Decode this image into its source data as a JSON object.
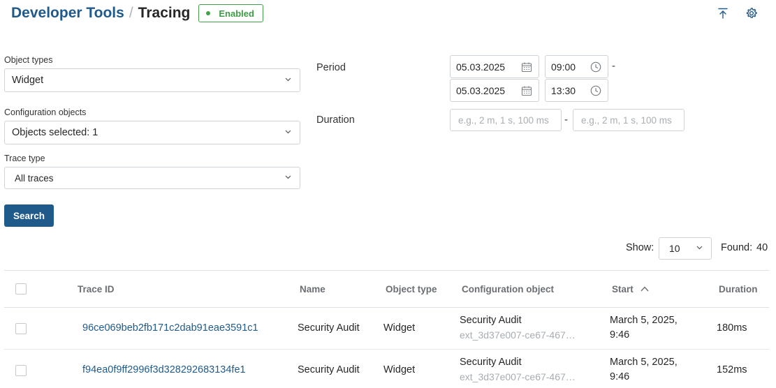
{
  "header": {
    "breadcrumb_root": "Developer Tools",
    "separator": "/",
    "title": "Tracing",
    "status_badge": "Enabled"
  },
  "toolbar_icons": [
    "export-icon",
    "gear-icon"
  ],
  "filters": {
    "object_types": {
      "label": "Object types",
      "value": "Widget"
    },
    "configuration_objects": {
      "label": "Configuration objects",
      "value": "Objects selected: 1"
    },
    "trace_type": {
      "label": "Trace type",
      "value": "All traces"
    },
    "period": {
      "label": "Period",
      "from_date": "05.03.2025",
      "from_time": "09:00",
      "to_date": "05.03.2025",
      "to_time": "13:30",
      "separator": "-"
    },
    "duration": {
      "label": "Duration",
      "from_placeholder": "e.g., 2 m, 1 s, 100 ms",
      "to_placeholder": "e.g., 2 m, 1 s, 100 ms",
      "separator": "-"
    }
  },
  "search_button": "Search",
  "results": {
    "show_label": "Show:",
    "page_size": "10",
    "found_label": "Found:",
    "found_count": "40"
  },
  "table": {
    "columns": {
      "trace_id": "Trace ID",
      "name": "Name",
      "object_type": "Object type",
      "configuration_object": "Configuration object",
      "start": "Start",
      "duration": "Duration"
    },
    "sort": {
      "column": "start",
      "direction": "ascending"
    },
    "rows": [
      {
        "trace_id": "96ce069beb2fb171c2dab91eae3591c1",
        "name": "Security Audit",
        "object_type": "Widget",
        "config_name": "Security Audit",
        "config_code": "ext_3d37e007-ce67-467…",
        "start_date": "March 5, 2025,",
        "start_time": "9:46",
        "duration": "180ms"
      },
      {
        "trace_id": "f94ea0f9ff2996f3d328292683134fe1",
        "name": "Security Audit",
        "object_type": "Widget",
        "config_name": "Security Audit",
        "config_code": "ext_3d37e007-ce67-467…",
        "start_date": "March 5, 2025,",
        "start_time": "9:46",
        "duration": "152ms"
      }
    ]
  },
  "colors": {
    "primary": "#1f5a8a",
    "enabled_green": "#46a04b",
    "border": "#cfd4d9",
    "header_text": "#6b6f73"
  }
}
